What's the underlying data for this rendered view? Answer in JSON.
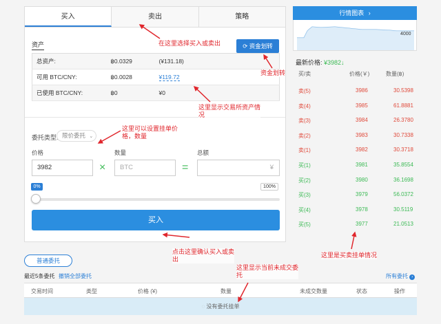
{
  "tabs": [
    {
      "label": "买入",
      "active": true
    },
    {
      "label": "卖出",
      "active": false
    },
    {
      "label": "策略",
      "active": false
    }
  ],
  "assets": {
    "title": "资产",
    "transfer_button": "资金划转",
    "rows": [
      {
        "label": "总资产:",
        "btc": "฿0.0329",
        "cny": "(¥131.18)"
      },
      {
        "label": "可用 BTC/CNY:",
        "btc": "฿0.0028",
        "cny": "¥119.72"
      },
      {
        "label": "已使用 BTC/CNY:",
        "btc": "฿0",
        "cny": "¥0"
      }
    ]
  },
  "order_form": {
    "type_label": "委托类型:",
    "type_value": "限价委托",
    "price_label": "价格",
    "quantity_label": "数量",
    "total_label": "总额",
    "price_value": "3982",
    "quantity_placeholder": "BTC",
    "total_unit": "¥",
    "percent_current": "0%",
    "percent_max": "100%",
    "percent_fraction": 0,
    "submit_label": "买入"
  },
  "market": {
    "chart_button": "行情图表",
    "chart_value_label": "4000",
    "latest_label": "最新价格: ",
    "latest_price": "¥3982↓",
    "headers": {
      "side": "买/卖",
      "price": "价格(￥)",
      "amount": "数量(฿)"
    },
    "asks": [
      {
        "label": "卖(5)",
        "price": "3986",
        "amount": "30.5398"
      },
      {
        "label": "卖(4)",
        "price": "3985",
        "amount": "61.8881"
      },
      {
        "label": "卖(3)",
        "price": "3984",
        "amount": "26.3780"
      },
      {
        "label": "卖(2)",
        "price": "3983",
        "amount": "30.7338"
      },
      {
        "label": "卖(1)",
        "price": "3982",
        "amount": "30.3718"
      }
    ],
    "bids": [
      {
        "label": "买(1)",
        "price": "3981",
        "amount": "35.8554"
      },
      {
        "label": "买(2)",
        "price": "3980",
        "amount": "36.1698"
      },
      {
        "label": "买(3)",
        "price": "3979",
        "amount": "56.0372"
      },
      {
        "label": "买(4)",
        "price": "3978",
        "amount": "30.5119"
      },
      {
        "label": "买(5)",
        "price": "3977",
        "amount": "21.0513"
      }
    ]
  },
  "orders": {
    "normal_tab": "普通委托",
    "recent_label": "最近5条委托",
    "cancel_all": "撤销全部委托",
    "all_orders": "所有委托",
    "columns": [
      "交易时间",
      "类型",
      "价格 (¥)",
      "数量",
      "未成交数量",
      "状态",
      "操作"
    ],
    "empty_text": "没有委托挂单"
  },
  "annotations": {
    "tab_note": "在这里选择买入或卖出",
    "transfer_note": "资金划转",
    "assets_note_1": "这里显示交易所资产情",
    "assets_note_2": "况",
    "price_note_1": "这里可以设置挂单价",
    "price_note_2": "格，数量",
    "confirm_note_1": "点击这里确认买入或卖",
    "confirm_note_2": "出",
    "orderbook_note": "这里是买卖挂单情况",
    "pending_note_1": "这里显示当前未成交委",
    "pending_note_2": "托"
  },
  "colors": {
    "accent": "#2b8ee0",
    "sell": "#e04a3b",
    "buy": "#3cba55",
    "annotation": "#e0262c"
  }
}
